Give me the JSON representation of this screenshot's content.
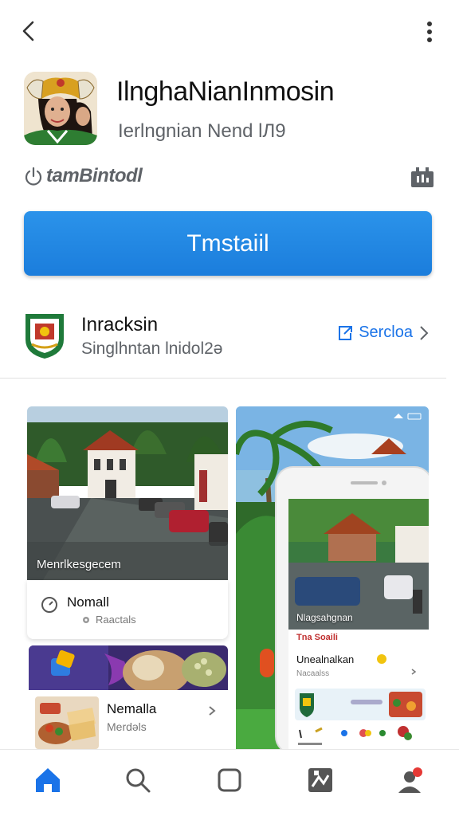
{
  "app": {
    "title": "IlnghaNianInmosin",
    "subtitle": "Ierlngnian Nend lЛ9"
  },
  "meta": {
    "label": "tamBintodl"
  },
  "install_button": {
    "label": "Tmstaiil"
  },
  "developer": {
    "name": "Inracksin",
    "subtitle": "Singlhntan lnidol2ə",
    "link_label": "Sercloa"
  },
  "screenshots": {
    "shot1": {
      "overlay_label": "Menrlkesgecem",
      "card_title": "Nomall",
      "card_sub": "Raactals"
    },
    "shot2": {
      "card_title": "Nemalla",
      "card_sub": "Merdəls"
    },
    "shot3": {
      "overlay_label": "Nlagsahgnan",
      "red_label": "Tna Soaili",
      "card_title": "Unealnalkan",
      "card_sub": "Nacaalss"
    }
  },
  "bottom_nav": {
    "items": [
      "home",
      "search",
      "apps",
      "library",
      "profile"
    ]
  },
  "colors": {
    "accent": "#1a73e8",
    "install": "#2b93ea",
    "text": "#202124"
  }
}
